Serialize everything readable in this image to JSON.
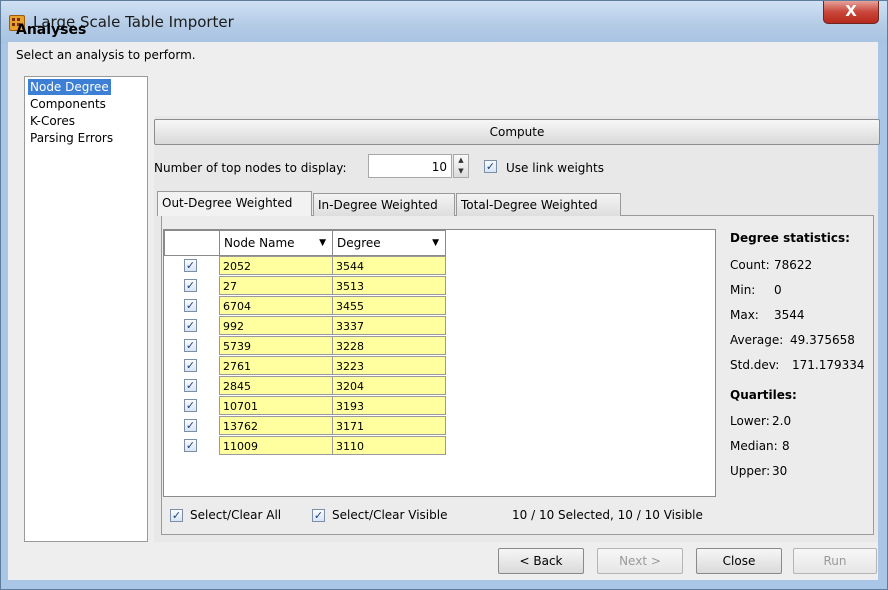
{
  "window": {
    "title": "Large Scale Table Importer",
    "close_glyph": "X"
  },
  "header": {
    "title": "Analyses",
    "subtitle": "Select an analysis to perform."
  },
  "analyses": [
    {
      "label": "Node Degree",
      "selected": true
    },
    {
      "label": "Components",
      "selected": false
    },
    {
      "label": "K-Cores",
      "selected": false
    },
    {
      "label": "Parsing Errors",
      "selected": false
    }
  ],
  "compute_label": "Compute",
  "top_nodes": {
    "label": "Number of top nodes to display:",
    "value": "10"
  },
  "use_link_weights": {
    "label": "Use link weights",
    "checked": true
  },
  "tabs": [
    {
      "label": "Out-Degree Weighted",
      "active": true
    },
    {
      "label": "In-Degree Weighted",
      "active": false
    },
    {
      "label": "Total-Degree Weighted",
      "active": false
    }
  ],
  "table": {
    "columns": [
      "Node Name",
      "Degree"
    ],
    "rows": [
      {
        "node": "2052",
        "degree": "3544",
        "checked": true
      },
      {
        "node": "27",
        "degree": "3513",
        "checked": true
      },
      {
        "node": "6704",
        "degree": "3455",
        "checked": true
      },
      {
        "node": "992",
        "degree": "3337",
        "checked": true
      },
      {
        "node": "5739",
        "degree": "3228",
        "checked": true
      },
      {
        "node": "2761",
        "degree": "3223",
        "checked": true
      },
      {
        "node": "2845",
        "degree": "3204",
        "checked": true
      },
      {
        "node": "10701",
        "degree": "3193",
        "checked": true
      },
      {
        "node": "13762",
        "degree": "3171",
        "checked": true
      },
      {
        "node": "11009",
        "degree": "3110",
        "checked": true
      }
    ]
  },
  "stats": {
    "title": "Degree statistics:",
    "items": [
      {
        "label": "Count:",
        "value": "78622"
      },
      {
        "label": "Min:",
        "value": "0"
      },
      {
        "label": "Max:",
        "value": "3544"
      },
      {
        "label": "Average:",
        "value": "49.375658"
      },
      {
        "label": "Std.dev:",
        "value": "171.179334"
      }
    ],
    "quartiles_title": "Quartiles:",
    "quartiles": [
      {
        "label": "Lower:",
        "value": "2.0"
      },
      {
        "label": "Median:",
        "value": "8"
      },
      {
        "label": "Upper:",
        "value": "30"
      }
    ]
  },
  "select_all": {
    "label": "Select/Clear All",
    "checked": true
  },
  "select_visible": {
    "label": "Select/Clear Visible",
    "checked": true
  },
  "status": "10 / 10 Selected, 10 / 10 Visible",
  "buttons": {
    "back": "< Back",
    "next": "Next >",
    "close": "Close",
    "run": "Run"
  }
}
